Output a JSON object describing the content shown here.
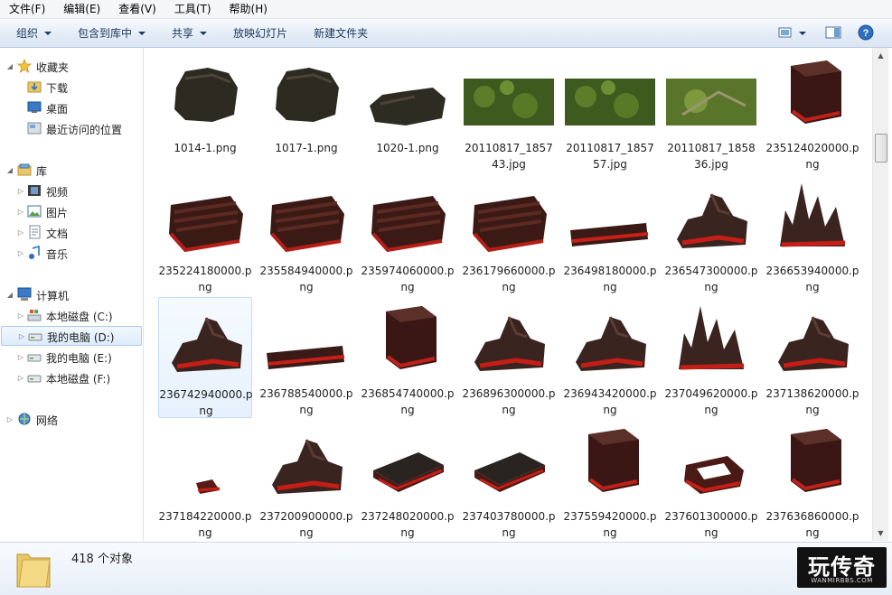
{
  "menu": [
    "文件(F)",
    "编辑(E)",
    "查看(V)",
    "工具(T)",
    "帮助(H)"
  ],
  "toolbar": {
    "organize": "组织",
    "include_in_library": "包含到库中",
    "share": "共享",
    "slideshow": "放映幻灯片",
    "new_folder": "新建文件夹"
  },
  "sidebar": {
    "favorites": "收藏夹",
    "downloads": "下载",
    "desktop": "桌面",
    "recent": "最近访问的位置",
    "libraries": "库",
    "videos": "视频",
    "pictures": "图片",
    "documents": "文档",
    "music": "音乐",
    "computer": "计算机",
    "drive_c": "本地磁盘 (C:)",
    "drive_d": "我的电脑 (D:)",
    "drive_e": "我的电脑 (E:)",
    "drive_f": "本地磁盘 (F:)",
    "network": "网络"
  },
  "files": [
    {
      "name": "1014-1.png",
      "kind": "rock-dark"
    },
    {
      "name": "1017-1.png",
      "kind": "rock-dark"
    },
    {
      "name": "1020-1.png",
      "kind": "rock-dark-flat"
    },
    {
      "name": "20110817_185743.jpg",
      "kind": "grass"
    },
    {
      "name": "20110817_185757.jpg",
      "kind": "grass"
    },
    {
      "name": "20110817_185836.jpg",
      "kind": "grass-light"
    },
    {
      "name": "235124020000.png",
      "kind": "box-red"
    },
    {
      "name": "235224180000.png",
      "kind": "planks-red"
    },
    {
      "name": "235584940000.png",
      "kind": "planks-red"
    },
    {
      "name": "235974060000.png",
      "kind": "planks-red"
    },
    {
      "name": "236179660000.png",
      "kind": "planks-red"
    },
    {
      "name": "236498180000.png",
      "kind": "flat-red"
    },
    {
      "name": "236547300000.png",
      "kind": "rock-red"
    },
    {
      "name": "236653940000.png",
      "kind": "spire-red"
    },
    {
      "name": "236742940000.png",
      "kind": "rock-red",
      "selected": true
    },
    {
      "name": "236788540000.png",
      "kind": "flat-red"
    },
    {
      "name": "236854740000.png",
      "kind": "box-red"
    },
    {
      "name": "236896300000.png",
      "kind": "rock-red"
    },
    {
      "name": "236943420000.png",
      "kind": "rock-red"
    },
    {
      "name": "237049620000.png",
      "kind": "spire-red"
    },
    {
      "name": "237138620000.png",
      "kind": "rock-red"
    },
    {
      "name": "237184220000.png",
      "kind": "small-red"
    },
    {
      "name": "237200900000.png",
      "kind": "rock-red"
    },
    {
      "name": "237248020000.png",
      "kind": "table-dark"
    },
    {
      "name": "237403780000.png",
      "kind": "table-dark"
    },
    {
      "name": "237559420000.png",
      "kind": "box-red"
    },
    {
      "name": "237601300000.png",
      "kind": "ring-red"
    },
    {
      "name": "237636860000.png",
      "kind": "box-red"
    }
  ],
  "status": {
    "count": "418 个对象"
  },
  "watermark": {
    "brand": "玩传奇",
    "domain": "WANMIRBBS.COM"
  },
  "colors": {
    "selection": "#dcecfc",
    "toolbar": "#e3ecf7",
    "text_accent": "#1e395b"
  }
}
